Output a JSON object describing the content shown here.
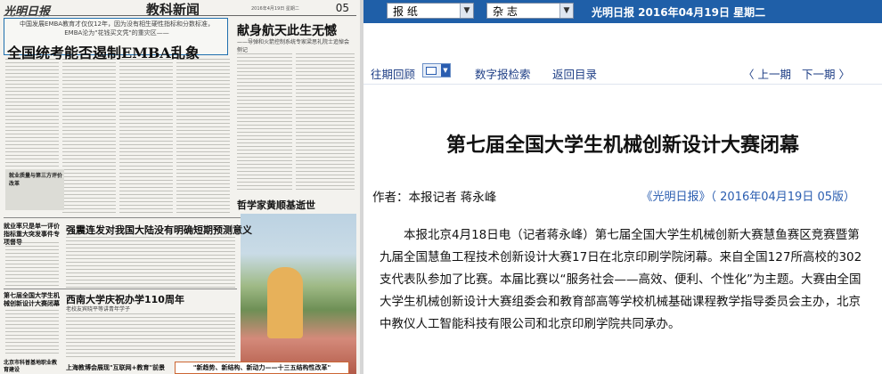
{
  "newspaper_page": {
    "masthead": "光明日报",
    "page_number": "05",
    "section_title": "教科新闻",
    "date_small": "2016年4月19日 星期二",
    "lead_subtitle": "中国发展EMBA教育才仅仅12年，因为没有相生硬性指标和分数标准，EMBA沦为\"花钱买文凭\"的重灾区——",
    "lead_headline": "全国统考能否遏制EMBA乱象",
    "side_headline": "献身航天此生无憾",
    "side_subtitle": "——导弹和火箭控制系统专家梁思礼院士追悼会侧记",
    "box_label": "就业质量与第三方评价改革",
    "philosopher_headline": "哲学家黄顺基逝世",
    "quake_headline": "强震连发对我国大陆没有明确短期预测意义",
    "southwest_headline": "西南大学庆祝办学110周年",
    "southwest_subtitle": "老校友宾晓平等讲青年学子",
    "left_headline_1": "就业率只是单一评价指标重大突发事件专项督导",
    "left_headline_2": "第七届全国大学生机械创新设计大赛闭幕",
    "left_headline_3": "北京市科普基地职业教育建设",
    "bottom_headline": "上海教博会展现\"互联网+教育\"前景",
    "bottom_box": "\"新趋势、新结构、新动力——十三五结构性改革\""
  },
  "toolbar": {
    "select_newspaper": "报 纸",
    "select_magazine": "杂 志",
    "date_line": "光明日报  2016年04月19日  星期二"
  },
  "nav": {
    "past_review": "往期回顾",
    "digital_search": "数字报检索",
    "back_to_index": "返回目录",
    "prev_issue": "〈 上一期",
    "next_issue": "下一期 〉"
  },
  "article": {
    "headline": "第七届全国大学生机械创新设计大赛闭幕",
    "byline": "作者：本报记者  蒋永峰",
    "source": "《光明日报》（ 2016年04月19日  05版）",
    "body": "本报北京4月18日电（记者蒋永峰）第七届全国大学生机械创新大赛慧鱼赛区竞赛暨第九届全国慧鱼工程技术创新设计大赛17日在北京印刷学院闭幕。来自全国127所高校的302支代表队参加了比赛。本届比赛以“服务社会——高效、便利、个性化”为主题。大赛由全国大学生机械创新设计大赛组委会和教育部高等学校机械基础课程教学指导委员会主办，北京中教仪人工智能科技有限公司和北京印刷学院共同承办。"
  },
  "colors": {
    "toolbar_bg": "#1f5fa8",
    "link_blue": "#2a5db0",
    "nav_text": "#1f3f86"
  }
}
